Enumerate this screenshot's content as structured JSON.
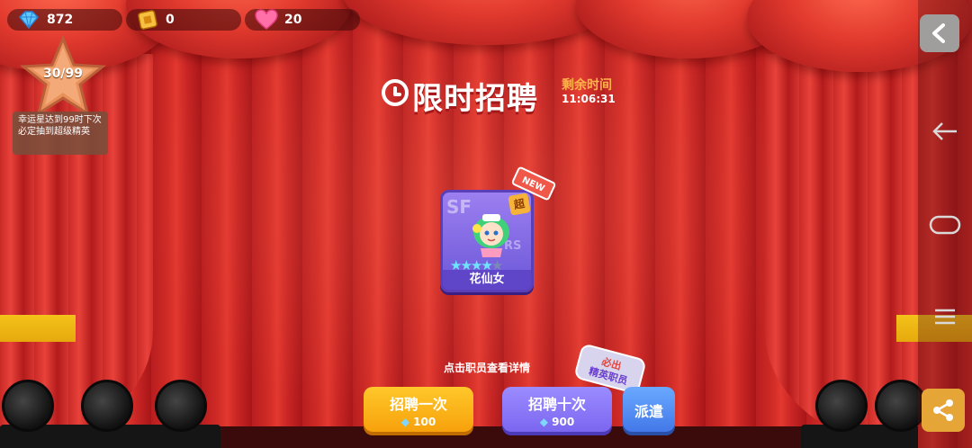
{
  "resources": {
    "gems": "872",
    "tickets": "0",
    "hearts": "20"
  },
  "lucky_star": {
    "progress": "30/99",
    "note": "幸运星达到99时下次必定抽到超级精英"
  },
  "event": {
    "title": "限时招聘",
    "remain_label": "剩余时间",
    "remain_time": "11:06:31"
  },
  "card": {
    "name": "花仙女",
    "new_tag": "NEW",
    "rarity_tag": "超",
    "bg_text_top": "SF",
    "bg_text_side": "RS",
    "stars_filled": 4,
    "stars_total": 5
  },
  "hint": "点击职员查看详情",
  "buttons": {
    "once_label": "招聘一次",
    "once_cost": "100",
    "ten_label": "招聘十次",
    "ten_cost": "900",
    "dispatch_label": "派遣",
    "bubble_line1": "必出",
    "bubble_line2": "精英职员"
  },
  "colors": {
    "curtain": "#d02b26",
    "title_shadow": "#a3181a",
    "once_btn": "#f7a10c",
    "ten_btn": "#7b66f0",
    "dispatch_btn": "#4278e8",
    "share_btn": "#e6a637"
  },
  "icons": {
    "gem": "gem-icon",
    "ticket": "ticket-icon",
    "heart": "heart-icon",
    "clock": "clock-icon",
    "share": "share-icon",
    "back": "back-arrow-icon",
    "home": "home-icon",
    "menu": "menu-icon",
    "collapse": "chevron-left-icon"
  }
}
